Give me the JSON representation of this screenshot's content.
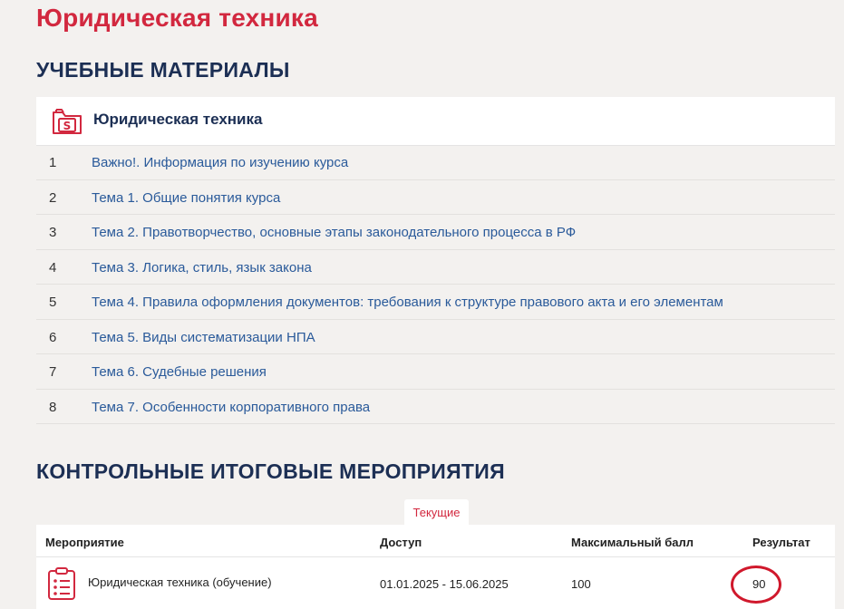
{
  "page": {
    "title": "Юридическая техника"
  },
  "materials": {
    "section_title": "УЧЕБНЫЕ МАТЕРИАЛЫ",
    "course": {
      "icon": "folder-s-icon",
      "name": "Юридическая техника"
    },
    "items": [
      {
        "num": "1",
        "title": "Важно!. Информация по изучению курса"
      },
      {
        "num": "2",
        "title": "Тема 1. Общие понятия курса"
      },
      {
        "num": "3",
        "title": "Тема 2. Правотворчество, основные этапы законодательного процесса в РФ"
      },
      {
        "num": "4",
        "title": "Тема 3. Логика, стиль, язык закона"
      },
      {
        "num": "5",
        "title": "Тема 4. Правила оформления документов: требования к структуре правового акта и его элементам"
      },
      {
        "num": "6",
        "title": "Тема 5. Виды систематизации НПА"
      },
      {
        "num": "7",
        "title": "Тема 6. Судебные решения"
      },
      {
        "num": "8",
        "title": "Тема 7. Особенности корпоративного права"
      }
    ]
  },
  "events": {
    "section_title": "КОНТРОЛЬНЫЕ ИТОГОВЫЕ МЕРОПРИЯТИЯ",
    "tab_label": "Текущие",
    "columns": {
      "event": "Мероприятие",
      "access": "Доступ",
      "max_score": "Максимальный балл",
      "result": "Результат"
    },
    "rows": [
      {
        "icon": "clipboard-list-icon",
        "name": "Юридическая техника (обучение)",
        "access": "01.01.2025 - 15.06.2025",
        "max_score": "100",
        "result": "90"
      }
    ]
  },
  "colors": {
    "accent_red": "#d2283f",
    "heading_navy": "#1c2f54",
    "link_blue": "#2a5a9a",
    "background": "#f3f1ef"
  }
}
